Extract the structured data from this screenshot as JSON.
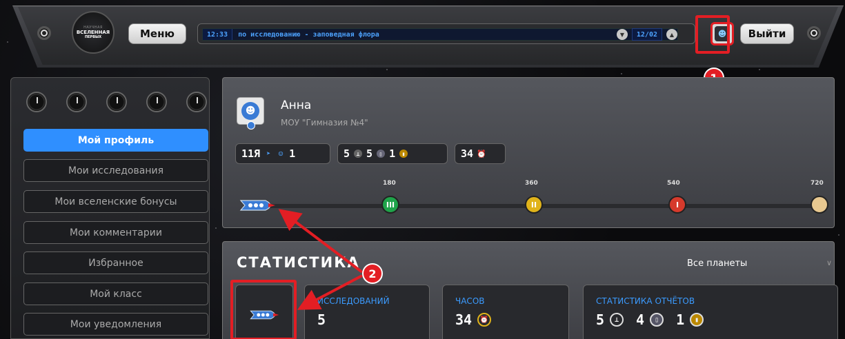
{
  "topbar": {
    "logo": {
      "line1": "НАУЧНАЯ",
      "line2": "ВСЕЛЕННАЯ",
      "line3": "ПЕРВЫХ"
    },
    "menu_label": "Меню",
    "ticker": {
      "time": "12:33",
      "text": "по исследованию - заповедная флора",
      "page": "12/02"
    },
    "logout_label": "Выйти"
  },
  "sidebar": {
    "items": [
      {
        "label": "Мой профиль"
      },
      {
        "label": "Мои исследования"
      },
      {
        "label": "Мои вселенские бонусы"
      },
      {
        "label": "Мои комментарии"
      },
      {
        "label": "Избранное"
      },
      {
        "label": "Мой класс"
      },
      {
        "label": "Мои уведомления"
      }
    ]
  },
  "profile": {
    "name": "Анна",
    "school": "МОУ \"Гимназия №4\"",
    "chips": {
      "rank": "11Я",
      "team_count": "1",
      "reports": [
        "5",
        "5",
        "1"
      ],
      "hours": "34"
    },
    "milestones": [
      {
        "label": "180",
        "mark": "III",
        "color": "#1fa34a"
      },
      {
        "label": "360",
        "mark": "II",
        "color": "#e0b31a"
      },
      {
        "label": "540",
        "mark": "I",
        "color": "#d63a2c"
      },
      {
        "label": "720",
        "mark": "",
        "color": "#e8c890"
      }
    ]
  },
  "stats": {
    "title": "СТАТИСТИКА",
    "filter": "Все планеты",
    "cards": {
      "research_label": "ИССЛЕДОВАНИЙ",
      "research_value": "5",
      "hours_label": "ЧАСОВ",
      "hours_value": "34",
      "reports_label": "СТАТИСТИКА ОТЧЁТОВ",
      "reports_values": [
        "5",
        "4",
        "1"
      ]
    }
  },
  "annotations": {
    "badge1": "1",
    "badge2": "2"
  }
}
